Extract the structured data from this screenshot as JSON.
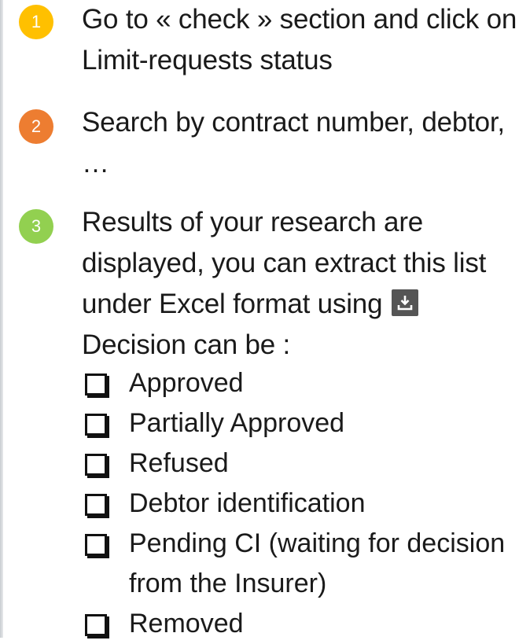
{
  "colors": {
    "step1": "#FFC000",
    "step2": "#ED7D31",
    "step3": "#92D050"
  },
  "steps": [
    {
      "number": "1",
      "text": "Go to « check » section and click on Limit-requests status"
    },
    {
      "number": "2",
      "text": "Search by contract number, debtor, …"
    },
    {
      "number": "3",
      "text": "Results of your research are displayed, you can extract this list under Excel format using",
      "icon": "download-icon",
      "text_after": "Decision can be :"
    }
  ],
  "decisions": [
    "Approved",
    "Partially Approved",
    "Refused",
    "Debtor identification",
    "Pending CI (waiting for decision from the Insurer)",
    "Removed"
  ]
}
